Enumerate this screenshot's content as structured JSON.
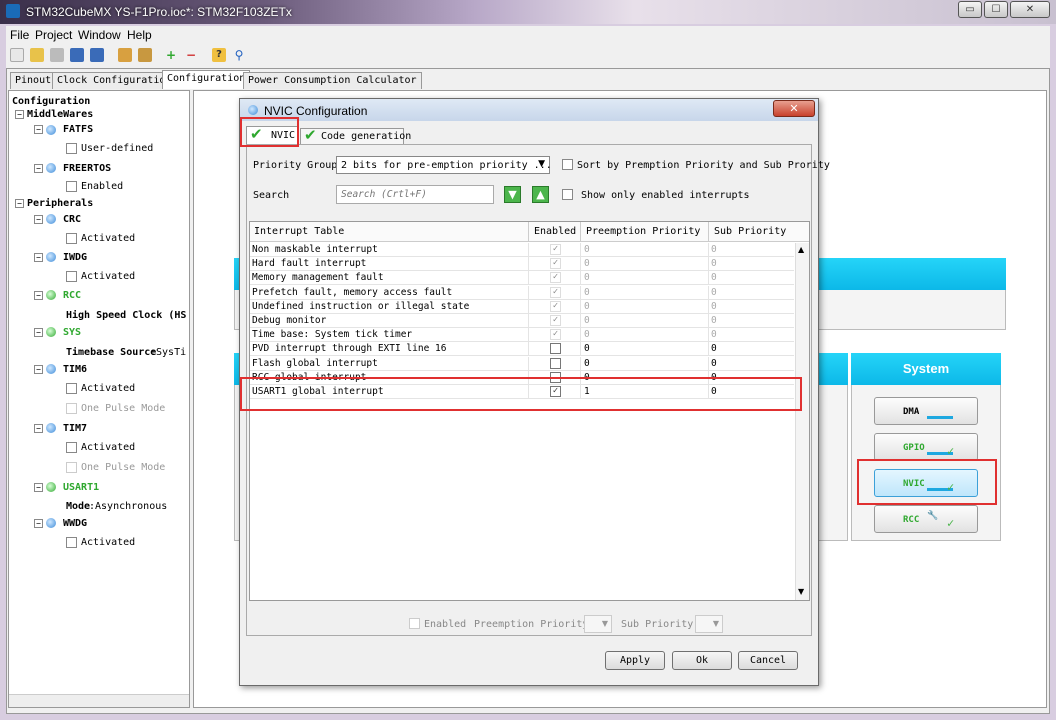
{
  "window": {
    "title": "STM32CubeMX YS-F1Pro.ioc*: STM32F103ZETx",
    "controls": [
      "▭",
      "☐",
      "✕"
    ]
  },
  "menu": [
    "File",
    "Project",
    "Window",
    "Help"
  ],
  "tabs": [
    "Pinout",
    "Clock Configuration",
    "Configuration",
    "Power Consumption Calculator"
  ],
  "tree": {
    "root": "Configuration",
    "middlewares": "MiddleWares",
    "fatfs": "FATFS",
    "fatfs_opt": "User-defined",
    "freertos": "FREERTOS",
    "freertos_opt": "Enabled",
    "peripherals": "Peripherals",
    "crc": "CRC",
    "crc_opt": "Activated",
    "iwdg": "IWDG",
    "iwdg_opt": "Activated",
    "rcc": "RCC",
    "rcc_hs_label": "High Speed Clock (HS",
    "sys": "SYS",
    "sys_tb_label": "Timebase Source",
    "sys_tb_value": ":SysTi",
    "tim6": "TIM6",
    "tim6_opt1": "Activated",
    "tim6_opt2": "One Pulse Mode",
    "tim7": "TIM7",
    "tim7_opt1": "Activated",
    "tim7_opt2": "One Pulse Mode",
    "usart1": "USART1",
    "usart1_mode_label": "Mode",
    "usart1_mode_value": ":Asynchronous",
    "wwdg": "WWDG",
    "wwdg_opt": "Activated"
  },
  "system": {
    "header": "System",
    "dma": "DMA",
    "gpio": "GPIO",
    "nvic": "NVIC",
    "rcc": "RCC"
  },
  "dialog": {
    "title": "NVIC Configuration",
    "tabs": [
      "NVIC",
      "Code generation"
    ],
    "priority_group_label": "Priority Group",
    "priority_group_value": "2 bits for pre-emption priority ...",
    "sort_label": "Sort by Premption Priority and Sub Prority",
    "search_label": "Search",
    "search_placeholder": "Search (Crtl+F)",
    "show_enabled_label": "Show only enabled interrupts",
    "columns": [
      "Interrupt Table",
      "Enabled",
      "Preemption Priority",
      "Sub Priority"
    ],
    "rows": [
      {
        "name": "Non maskable interrupt",
        "enabled": true,
        "pre": "0",
        "sub": "0",
        "locked": true
      },
      {
        "name": "Hard fault interrupt",
        "enabled": true,
        "pre": "0",
        "sub": "0",
        "locked": true
      },
      {
        "name": "Memory management fault",
        "enabled": true,
        "pre": "0",
        "sub": "0",
        "locked": true
      },
      {
        "name": "Prefetch fault, memory access fault",
        "enabled": true,
        "pre": "0",
        "sub": "0",
        "locked": true
      },
      {
        "name": "Undefined instruction or illegal state",
        "enabled": true,
        "pre": "0",
        "sub": "0",
        "locked": true
      },
      {
        "name": "Debug monitor",
        "enabled": true,
        "pre": "0",
        "sub": "0",
        "locked": true
      },
      {
        "name": "Time base: System tick timer",
        "enabled": true,
        "pre": "0",
        "sub": "0",
        "locked": true
      },
      {
        "name": "PVD interrupt through EXTI line 16",
        "enabled": false,
        "pre": "0",
        "sub": "0",
        "locked": false
      },
      {
        "name": "Flash global interrupt",
        "enabled": false,
        "pre": "0",
        "sub": "0",
        "locked": false
      },
      {
        "name": "RCC global interrupt",
        "enabled": false,
        "pre": "0",
        "sub": "0",
        "locked": false
      },
      {
        "name": "USART1 global interrupt",
        "enabled": true,
        "pre": "1",
        "sub": "0",
        "locked": false
      }
    ],
    "bottom_enabled": "Enabled",
    "bottom_pre": "Preemption Priority",
    "bottom_sub": "Sub Priority",
    "apply": "Apply",
    "ok": "Ok",
    "cancel": "Cancel"
  },
  "colors": {
    "accent": "#0cb8e8",
    "highlight": "#e03030",
    "check": "#2fa82f"
  }
}
